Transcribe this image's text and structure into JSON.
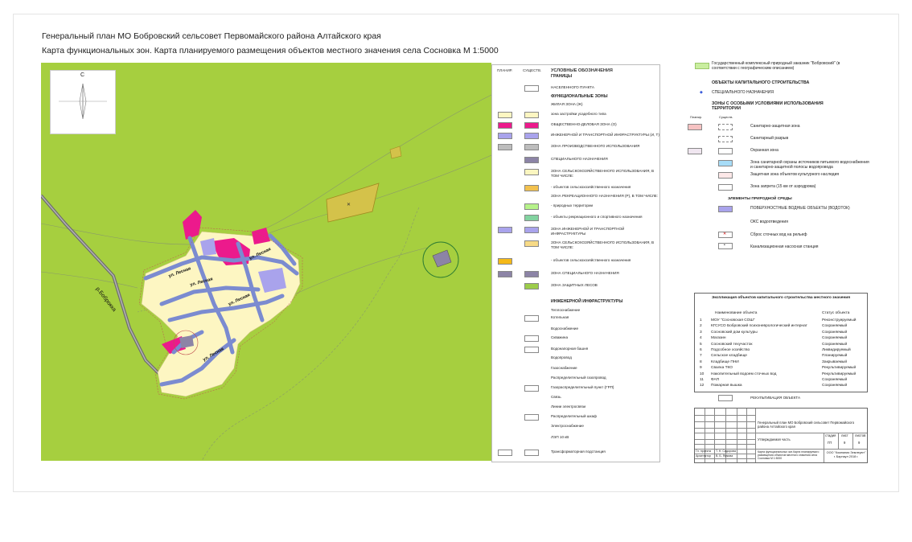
{
  "title": {
    "line1": "Генеральный план МО Бобровский сельсовет Первомайского района Алтайского края",
    "line2": "Карта функциональных зон. Карта планируемого размещения объектов местного значения села Сосновка   М 1:5000"
  },
  "map": {
    "compass_label": "С",
    "river_label": "р.Боброкка",
    "streets": [
      "ул. Лесная",
      "ул. Лесная",
      "ул. Лесная",
      "ул. Лесная",
      "ул. Лесная"
    ],
    "colors": {
      "background": "#a6cf3f",
      "residential": "#fdf6c2",
      "public": "#ec1a8c",
      "infrastructure": "#a9a3ec",
      "roads": "#7b8bd0",
      "special": "#8c84a6",
      "agricultural": "#d4c24a"
    }
  },
  "legend": {
    "col_plan": "ПЛАНИР.",
    "col_exist": "СУЩЕСТВ.",
    "title": "УСЛОВНЫЕ ОБОЗНАЧЕНИЯ",
    "items": [
      {
        "label": "ГРАНИЦЫ",
        "heading": true,
        "plan": "",
        "exist": ""
      },
      {
        "label": "НАСЕЛЕННОГО ПУНКТА",
        "plan": "",
        "exist": "#ffffff"
      },
      {
        "label": "ФУНКЦИОНАЛЬНЫЕ ЗОНЫ",
        "heading": true,
        "plan": "",
        "exist": ""
      },
      {
        "label": "ЖИЛАЯ ЗОНА (Ж)",
        "plan": "",
        "exist": ""
      },
      {
        "label": "зона застройки усадебного типа",
        "plan": "#fdf6c2",
        "exist": "#fdf6c2"
      },
      {
        "label": "ОБЩЕСТВЕННО-ДЕЛОВАЯ ЗОНА (О)",
        "plan": "#ec1a8c",
        "exist": "#ec1a8c"
      },
      {
        "label": "ИНЖЕНЕРНОЙ И ТРАНСПОРТНОЙ ИНФРАСТРУКТУРЫ (И, Т)",
        "plan": "#a9a3ec",
        "exist": "#a9a3ec"
      },
      {
        "label": "ЗОНА ПРОИЗВОДСТВЕННОГО ИСПОЛЬЗОВАНИЯ",
        "plan": "#bdbdbd",
        "exist": "#bdbdbd"
      },
      {
        "label": "СПЕЦИАЛЬНОГО НАЗНАЧЕНИЯ",
        "plan": "",
        "exist": "#8c84a6"
      },
      {
        "label": "ЗОНА СЕЛЬСКОХОЗЯЙСТВЕННОГО ИСПОЛЬЗОВАНИЯ, В ТОМ ЧИСЛЕ:",
        "plan": "",
        "exist": "#fbf6c0"
      },
      {
        "label": "- объектов сельскохозяйственного назначения",
        "plan": "",
        "exist": "#f2c14e"
      },
      {
        "label": "ЗОНА РЕКРЕАЦИОННОГО НАЗНАЧЕНИЯ (Р), В ТОМ ЧИСЛЕ:",
        "plan": "",
        "exist": ""
      },
      {
        "label": "- природных территории",
        "plan": "",
        "exist": "#b6f28a"
      },
      {
        "label": "- объекты рекреационного и спортивного назначения",
        "plan": "",
        "exist": "#82d3a0"
      },
      {
        "label": "ЗОНА ИНЖЕНЕРНОЙ И ТРАНСПОРТНОЙ ИНФРАСТРУКТУРЫ",
        "plan": "#a9a3ec",
        "exist": "#a9a3ec"
      },
      {
        "label": "ЗОНА СЕЛЬСКОХОЗЯЙСТВЕННОГО ИСПОЛЬЗОВАНИЯ, В ТОМ ЧИСЛЕ:",
        "plan": "",
        "exist": "#f7da86"
      },
      {
        "label": "- объектов сельскохозяйственного назначения",
        "plan": "#f5b918",
        "exist": ""
      },
      {
        "label": "ЗОНА СПЕЦИАЛЬНОГО НАЗНАЧЕНИЯ",
        "plan": "#8c84a6",
        "exist": "#8c84a6"
      },
      {
        "label": "ЗОНА ЗАЩИТНЫХ ЛЕСОВ",
        "plan": "",
        "exist": "#9ccc4a"
      },
      {
        "label": "ИНЖЕНЕРНОЙ ИНФРАСТРУКТУРЫ",
        "heading": true,
        "plan": "",
        "exist": ""
      },
      {
        "label": "Теплоснабжение",
        "plan": "",
        "exist": ""
      },
      {
        "label": "Котельная",
        "plan": "",
        "exist": "#ffffff"
      },
      {
        "label": "Водоснабжение",
        "plan": "",
        "exist": ""
      },
      {
        "label": "Скважина",
        "plan": "",
        "exist": "#ffffff"
      },
      {
        "label": "Водонапорная башня",
        "plan": "",
        "exist": "#ffffff"
      },
      {
        "label": "Водопровод",
        "plan": "",
        "exist": ""
      },
      {
        "label": "Газоснабжение",
        "plan": "",
        "exist": ""
      },
      {
        "label": "Распределительный газопровод",
        "plan": "",
        "exist": ""
      },
      {
        "label": "Газораспределительный пункт (ГРП)",
        "plan": "",
        "exist": "#ffffff"
      },
      {
        "label": "Связь",
        "plan": "",
        "exist": ""
      },
      {
        "label": "Линии электросвязи",
        "plan": "",
        "exist": ""
      },
      {
        "label": "Распределительный шкаф",
        "plan": "",
        "exist": "#ffffff"
      },
      {
        "label": "Электроснабжение",
        "plan": "",
        "exist": ""
      },
      {
        "label": "ЛЭП 10 кВ",
        "plan": "",
        "exist": ""
      },
      {
        "label": "Трансформаторная подстанция",
        "plan": "#ffffff",
        "exist": "#ffffff"
      }
    ]
  },
  "right_panel": {
    "reserve": "Государственный комплексный природный заказник \"Бобровский\" (в соответствии с географическим описанием)",
    "capital_heading": "ОБЪЕКТЫ КАПИТАЛЬНОГО СТРОИТЕЛЬСТВА",
    "capital_item": "СПЕЦИАЛЬНОГО НАЗНАЧЕНИЯ",
    "zones_heading": "ЗОНЫ С ОСОБЫМИ УСЛОВИЯМИ ИСПОЛЬЗОВАНИЯ ТЕРРИТОРИИ",
    "col_plan": "Планир.",
    "col_exist": "Существ.",
    "zones": [
      "Санитарно-защитная зона",
      "Санитарный разрыв",
      "Охранная зона",
      "Зона санитарной охраны источников питьевого водоснабжения и санитарно-защитной полосы водопровода",
      "Защитная зона объектов культурного наследия",
      "Зона запрета (15 км от аэродрома)"
    ],
    "nature_heading": "ЭЛЕМЕНТЫ ПРИРОДНОЙ СРЕДЫ",
    "nature_items": [
      "ПОВЕРХНОСТНЫЕ ВОДНЫЕ ОБЪЕКТЫ (ВОДОТОК)",
      "ОКС водоотведения",
      "Сброс сточных вод на рельеф",
      "Канализационная насосная станция"
    ],
    "recult": "РЕКУЛЬТИВАЦИЯ ОБЪЕКТА"
  },
  "explication": {
    "title": "Экспликация объектов капитального строительства местного значения",
    "col_name": "Наименование объекта",
    "col_status": "Статус объекта",
    "rows": [
      {
        "n": "1",
        "name": "МОУ \"Сосновская СОШ\"",
        "status": "Реконструируемый"
      },
      {
        "n": "2",
        "name": "КГСУСО Бобровский психоневрологический интернат",
        "status": "Сохраняемый"
      },
      {
        "n": "3",
        "name": "Сосновский дом культуры",
        "status": "Сохраняемый"
      },
      {
        "n": "4",
        "name": "Магазин",
        "status": "Сохраняемый"
      },
      {
        "n": "5",
        "name": "Сосновский техучасток",
        "status": "Сохраняемый"
      },
      {
        "n": "6",
        "name": "Подсобное хозяйство",
        "status": "Ликвидируемый"
      },
      {
        "n": "7",
        "name": "Сельское кладбище",
        "status": "Планируемый"
      },
      {
        "n": "8",
        "name": "Кладбище ПНИ",
        "status": "Закрываемый"
      },
      {
        "n": "9",
        "name": "Свалка ТКО",
        "status": "Рекультивируемый"
      },
      {
        "n": "10",
        "name": "Накопительный водоем сточных вод",
        "status": "Рекультивируемый"
      },
      {
        "n": "11",
        "name": "ФАП",
        "status": "Сохраняемый"
      },
      {
        "n": "12",
        "name": "Пожарная вышка",
        "status": "Сохраняемый"
      }
    ]
  },
  "stamp": {
    "project": "Генеральный план МО Бобровский сельсовет Первомайского района Алтайского края",
    "part": "Утверждаемая часть",
    "stage_h": "стадия",
    "sheet_h": "лист",
    "sheets_h": "листов",
    "stage": "ГП",
    "sheet": "9",
    "sheets": "9",
    "role1": "Гл. проекта",
    "name1": "Т. Н. Сидорова",
    "role2": "Архитектор",
    "name2": "В. Б. Ямкова",
    "desc": "Карта функциональных зон.Карта планируемого размещения объектов местного значения села Сосновка М 1:5000",
    "org": "ООО \"Компания Землеуют\" г. Барнаул 2018 г."
  }
}
